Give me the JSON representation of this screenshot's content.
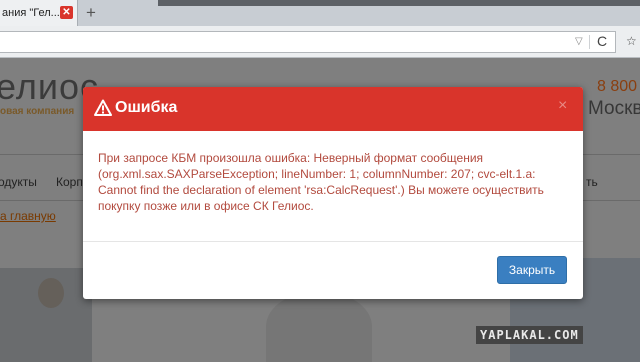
{
  "browser": {
    "tab_title": "ания \"Гел...",
    "tab_close_glyph": "✕",
    "new_tab_glyph": "+",
    "url": "",
    "url_dropdown_glyph": "▽",
    "reload_glyph": "C",
    "bookmark_glyph": "☆"
  },
  "page": {
    "logo_text": "елиос",
    "logo_tagline": "овая компания",
    "phone": "8 800",
    "city": "Москве",
    "nav": [
      "одукты",
      "Корп",
      "ть"
    ],
    "breadcrumb": "а главную"
  },
  "modal": {
    "title": "Ошибка",
    "close_glyph": "×",
    "message": "При запросе КБМ произошла ошибка: Неверный формат сообщения (org.xml.sax.SAXParseException; lineNumber: 1; columnNumber: 207; cvc-elt.1.a: Cannot find the declaration of element 'rsa:CalcRequest'.) Вы можете осуществить покупку позже или в офисе СК Гелиос.",
    "button_label": "Закрыть"
  },
  "watermark": "YAPLAKAL.COM",
  "colors": {
    "header_red": "#d9342b",
    "button_blue": "#3a7fc1",
    "message_text": "#b24a3e"
  }
}
